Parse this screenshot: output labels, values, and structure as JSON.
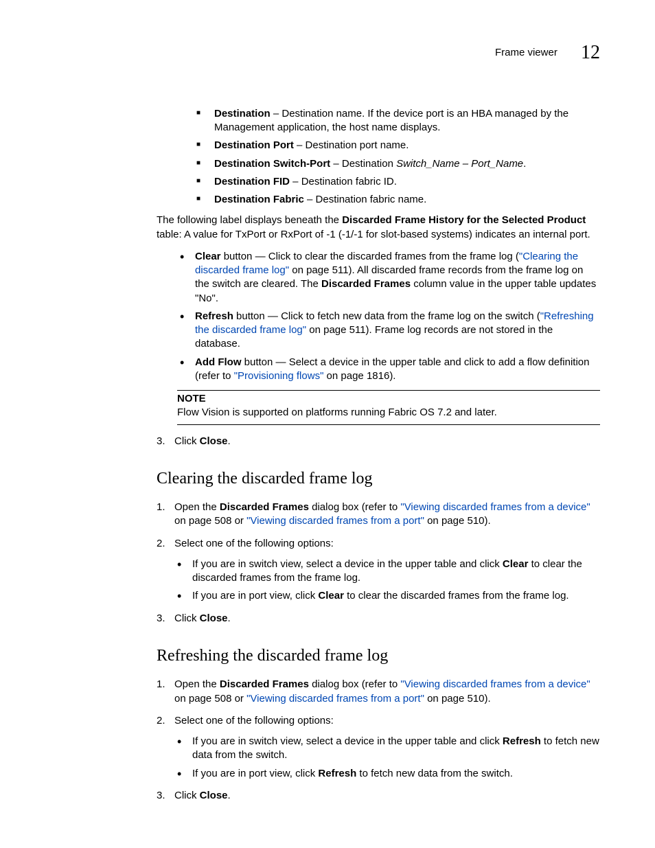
{
  "header": {
    "title": "Frame viewer",
    "chapter": "12"
  },
  "defs": [
    {
      "term": "Destination",
      "desc": " – Destination name. If the device port is an HBA managed by the Management application, the host name displays."
    },
    {
      "term": "Destination Port",
      "desc": " – Destination port name."
    },
    {
      "term": "Destination Switch-Port",
      "desc": " – Destination ",
      "italic": "Switch_Name – Port_Name",
      "tail": "."
    },
    {
      "term": "Destination FID",
      "desc": " – Destination fabric ID."
    },
    {
      "term": "Destination Fabric",
      "desc": " – Destination fabric name."
    }
  ],
  "intro": {
    "pre": "The following label displays beneath the ",
    "bold": "Discarded Frame History for the Selected Product",
    "post": " table: A value for TxPort or RxPort of -1 (-1/-1 for slot-based systems) indicates an internal port."
  },
  "buttons": {
    "clear": {
      "term": "Clear",
      "a": " button — Click to clear the discarded frames from the frame log (",
      "link": "\"Clearing the discarded frame log\"",
      "b": " on page 511). All discarded frame records from the frame log on the switch are cleared. The ",
      "bold2": "Discarded Frames",
      "c": " column value in the upper table updates \"No\"."
    },
    "refresh": {
      "term": "Refresh",
      "a": " button — Click to fetch new data from the frame log on the switch (",
      "link": "\"Refreshing the discarded frame log\"",
      "b": " on page 511). Frame log records are not stored in the database."
    },
    "addflow": {
      "term": "Add Flow",
      "a": " button — Select a device in the upper table and click to add a flow definition (refer to ",
      "link": "\"Provisioning flows\"",
      "b": " on page 1816)."
    }
  },
  "note": {
    "label": "NOTE",
    "body": "Flow Vision is supported on platforms running Fabric OS 7.2 and later."
  },
  "step_close": {
    "num": "3.",
    "pre": "Click ",
    "bold": "Close",
    "post": "."
  },
  "section1": {
    "title": "Clearing the discarded frame log",
    "s1": {
      "num": "1.",
      "a": "Open the ",
      "bold1": "Discarded Frames",
      "b": " dialog box (refer to ",
      "link1": "\"Viewing discarded frames from a device\"",
      "c": " on page 508 or ",
      "link2": "\"Viewing discarded frames from a port\"",
      "d": " on page 510)."
    },
    "s2": {
      "num": "2.",
      "text": "Select one of the following options:"
    },
    "opt1": {
      "a": "If you are in switch view, select a device in the upper table and click ",
      "bold": "Clear",
      "b": " to clear the discarded frames from the frame log."
    },
    "opt2": {
      "a": "If you are in port view, click ",
      "bold": "Clear",
      "b": " to clear the discarded frames from the frame log."
    },
    "s3": {
      "num": "3.",
      "pre": "Click ",
      "bold": "Close",
      "post": "."
    }
  },
  "section2": {
    "title": "Refreshing the discarded frame log",
    "s1": {
      "num": "1.",
      "a": "Open the ",
      "bold1": "Discarded Frames",
      "b": " dialog box (refer to ",
      "link1": "\"Viewing discarded frames from a device\"",
      "c": " on page 508 or ",
      "link2": "\"Viewing discarded frames from a port\"",
      "d": " on page 510)."
    },
    "s2": {
      "num": "2.",
      "text": "Select one of the following options:"
    },
    "opt1": {
      "a": "If you are in switch view, select a device in the upper table and click ",
      "bold": "Refresh",
      "b": " to fetch new data from the switch."
    },
    "opt2": {
      "a": "If you are in port view, click ",
      "bold": "Refresh",
      "b": " to fetch new data from the switch."
    },
    "s3": {
      "num": "3.",
      "pre": "Click ",
      "bold": "Close",
      "post": "."
    }
  }
}
